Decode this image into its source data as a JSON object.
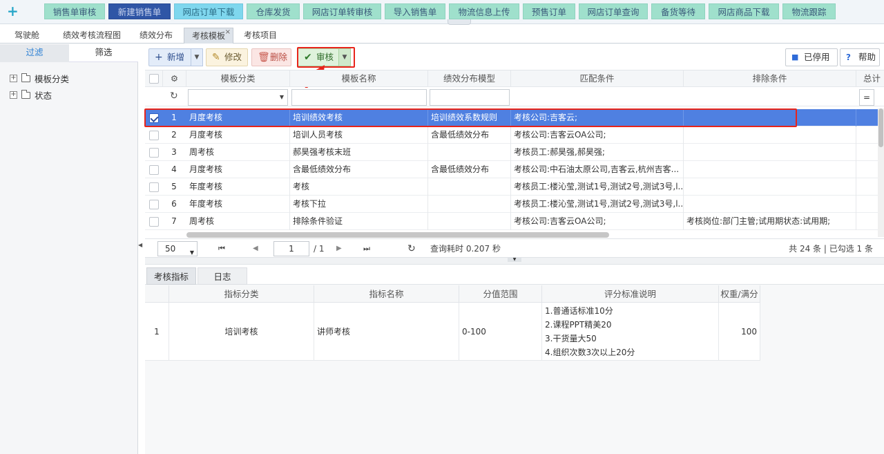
{
  "quick_menu": [
    "销售单审核",
    "新建销售单",
    "网店订单下载",
    "仓库发货",
    "网店订单转审核",
    "导入销售单",
    "物流信息上传",
    "预售订单",
    "网店订单查询",
    "备货等待",
    "网店商品下载",
    "物流跟踪"
  ],
  "tabs": [
    "驾驶舱",
    "绩效考核流程图",
    "绩效分布",
    "考核模板",
    "考核项目"
  ],
  "left_panel": {
    "tab_filter": "过滤",
    "tab_select": "筛选",
    "tree": [
      "模板分类",
      "状态"
    ]
  },
  "toolbar": {
    "add": "新增",
    "edit": "修改",
    "delete": "删除",
    "audit": "审核",
    "disabled": "已停用",
    "help": "帮助"
  },
  "grid": {
    "headers": [
      "模板分类",
      "模板名称",
      "绩效分布模型",
      "匹配条件",
      "排除条件",
      "总计"
    ],
    "rows": [
      {
        "no": "1",
        "cat": "月度考核",
        "name": "培训绩效考核",
        "model": "培训绩效系数规则",
        "match": "考核公司:吉客云;",
        "exclude": "",
        "checked": true
      },
      {
        "no": "2",
        "cat": "月度考核",
        "name": "培训人员考核",
        "model": "含最低绩效分布",
        "match": "考核公司:吉客云OA公司;",
        "exclude": "",
        "checked": false
      },
      {
        "no": "3",
        "cat": "周考核",
        "name": "郝昊强考核末班",
        "model": "",
        "match": "考核员工:郝昊强,郝昊强;",
        "exclude": "",
        "checked": false
      },
      {
        "no": "4",
        "cat": "月度考核",
        "name": "含最低绩效分布",
        "model": "含最低绩效分布",
        "match": "考核公司:中石油太原公司,吉客云,杭州吉客...",
        "exclude": "",
        "checked": false
      },
      {
        "no": "5",
        "cat": "年度考核",
        "name": "考核",
        "model": "",
        "match": "考核员工:楼沁莹,测试1号,测试2号,测试3号,l...",
        "exclude": "",
        "checked": false
      },
      {
        "no": "6",
        "cat": "年度考核",
        "name": "考核下拉",
        "model": "",
        "match": "考核员工:楼沁莹,测试1号,测试2号,测试3号,l...",
        "exclude": "",
        "checked": false
      },
      {
        "no": "7",
        "cat": "周考核",
        "name": "排除条件验证",
        "model": "",
        "match": "考核公司:吉客云OA公司;",
        "exclude": "考核岗位:部门主管;试用期状态:试用期;",
        "checked": false
      }
    ]
  },
  "pager": {
    "page_size": "50",
    "page": "1",
    "total_pages": "/ 1",
    "query_time": "查询耗时 0.207 秒",
    "summary": "共 24 条 | 已勾选 1 条"
  },
  "bottom_tabs": [
    "考核指标",
    "日志"
  ],
  "indicator_table": {
    "headers": [
      "指标分类",
      "指标名称",
      "分值范围",
      "评分标准说明",
      "权重/满分"
    ],
    "row": {
      "no": "1",
      "cat": "培训考核",
      "name": "讲师考核",
      "range": "0-100",
      "desc": [
        "1.普通话标准10分",
        "2.课程PPT精美20",
        "3.干货量大50",
        "4.组织次数3次以上20分"
      ],
      "weight": "100"
    }
  }
}
